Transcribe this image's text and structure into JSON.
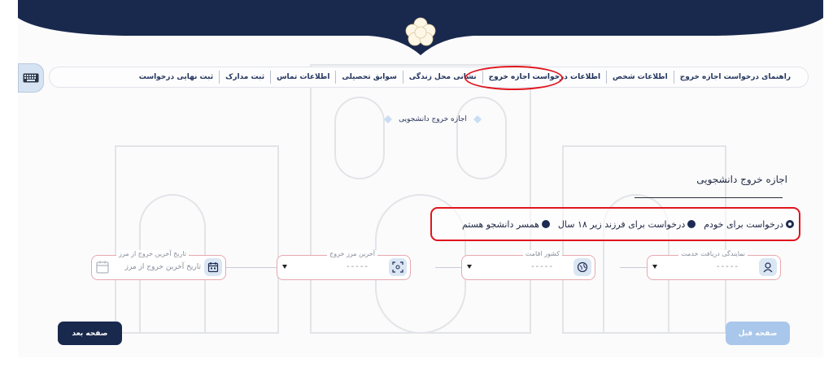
{
  "tabs": [
    {
      "label": "راهنمای درخواست اجازه خروج",
      "active": false
    },
    {
      "label": "اطلاعات شخص",
      "active": false
    },
    {
      "label": "اطلاعات درخواست اجازه خروج",
      "active": true
    },
    {
      "label": "نشانی محل زندگی",
      "active": false
    },
    {
      "label": "سوابق تحصیلی",
      "active": false
    },
    {
      "label": "اطلاعات تماس",
      "active": false
    },
    {
      "label": "ثبت مدارک",
      "active": false
    },
    {
      "label": "ثبت نهایی درخواست",
      "active": false
    }
  ],
  "section": {
    "title": "اجازه خروج دانشجویی"
  },
  "form": {
    "type_value": "اجازه خروج دانشجویی",
    "radios": [
      {
        "label": "درخواست برای خودم",
        "selected": true
      },
      {
        "label": "درخواست برای فرزند زیر ۱۸ سال",
        "selected": false
      },
      {
        "label": "همسر دانشجو هستم",
        "selected": false
      }
    ],
    "fields": {
      "service_office": {
        "label": "نمایندگی دریافت خدمت",
        "value": "-----",
        "icon": "user-icon"
      },
      "residence_country": {
        "label": "کشور اقامت",
        "value": "-----",
        "icon": "globe-icon"
      },
      "last_exit_border": {
        "label": "آخرین مرز خروج",
        "value": "-----",
        "icon": "scan-icon"
      },
      "last_exit_date": {
        "label": "تاریخ آخرین خروج از مرز",
        "placeholder": "تاریخ آخرین خروج از مرز",
        "icon": "calendar-icon"
      }
    }
  },
  "buttons": {
    "next": "صفحه بعد",
    "prev": "صفحه قبل"
  },
  "colors": {
    "navy": "#19294d",
    "highlight_red": "#e0151d",
    "prev_button": "#a9c7ea",
    "field_border": "#e6a8ae"
  }
}
